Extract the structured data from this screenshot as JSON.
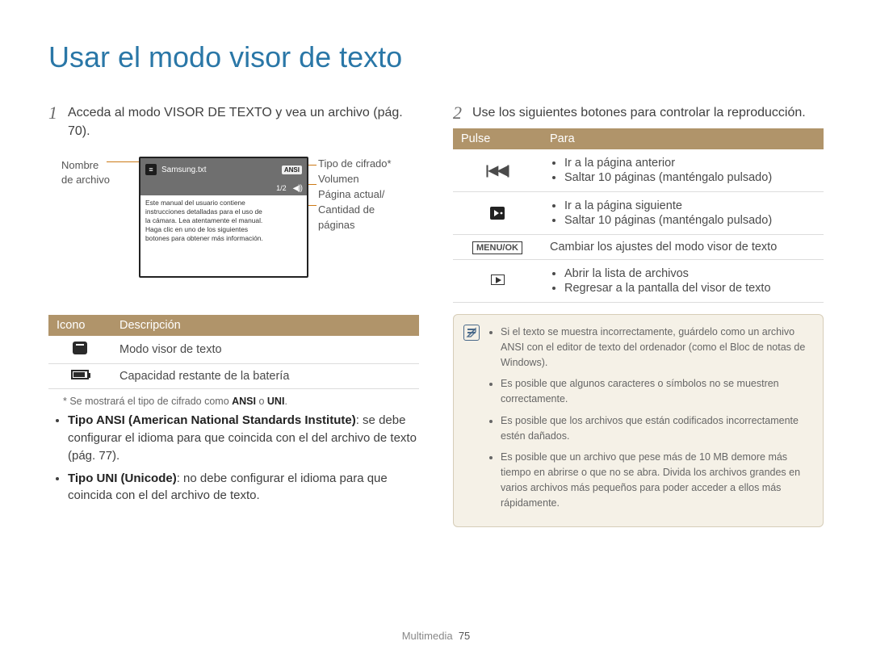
{
  "title": "Usar el modo visor de texto",
  "step1": {
    "num": "1",
    "text": "Acceda al modo VISOR DE TEXTO y vea un archivo (pág. 70)."
  },
  "diagram": {
    "filename_label": "Nombre\nde archivo",
    "filename": "Samsung.txt",
    "ansi_badge": "ANSI",
    "pagepos": "1/2",
    "body": "Este manual del usuario contiene\ninstrucciones detalladas para el uso de\nla cámara. Lea atentamente el manual.\nHaga clic en uno de los siguientes\nbotones para obtener más información.",
    "callouts": {
      "c1": "Tipo de cifrado*",
      "c2": "Volumen",
      "c3": "Página actual/\nCantidad de\npáginas"
    }
  },
  "table1": {
    "h1": "Icono",
    "h2": "Descripción",
    "rows": [
      {
        "desc": "Modo visor de texto"
      },
      {
        "desc": "Capacidad restante de la batería"
      }
    ]
  },
  "footnote_pre": "* Se mostrará el tipo de cifrado como ",
  "footnote_a": "ANSI",
  "footnote_mid": " o ",
  "footnote_b": "UNI",
  "footnote_post": ".",
  "bullets_left": [
    {
      "lead": "Tipo ANSI (American National Standards Institute)",
      "rest": ": se debe configurar el idioma para que coincida con el del archivo de texto (pág. 77)."
    },
    {
      "lead": "Tipo UNI (Unicode)",
      "rest": ": no debe configurar el idioma para que coincida con el del archivo de texto."
    }
  ],
  "step2": {
    "num": "2",
    "text": "Use los siguientes botones para controlar la reproducción."
  },
  "table2": {
    "h1": "Pulse",
    "h2": "Para",
    "rows": [
      {
        "key": "prev",
        "items": [
          "Ir a la página anterior",
          "Saltar 10 páginas (manténgalo pulsado)"
        ]
      },
      {
        "key": "next",
        "items": [
          "Ir a la página siguiente",
          "Saltar 10 páginas (manténgalo pulsado)"
        ]
      },
      {
        "key": "menu",
        "label": "MENU/OK",
        "items": [
          "Cambiar los ajustes del modo visor de texto"
        ]
      },
      {
        "key": "play",
        "items": [
          "Abrir la lista de archivos",
          "Regresar a la pantalla del visor de texto"
        ]
      }
    ]
  },
  "note": [
    "Si el texto se muestra incorrectamente, guárdelo como un archivo ANSI con el editor de texto del ordenador (como el Bloc de notas de Windows).",
    "Es posible que algunos caracteres o símbolos no se muestren correctamente.",
    "Es posible que los archivos que están codificados incorrectamente estén dañados.",
    "Es posible que un archivo que pese más de 10 MB demore más tiempo en abrirse o que no se abra. Divida los archivos grandes en varios archivos más pequeños para poder acceder a ellos más rápidamente."
  ],
  "footer": {
    "section": "Multimedia",
    "page": "75"
  }
}
